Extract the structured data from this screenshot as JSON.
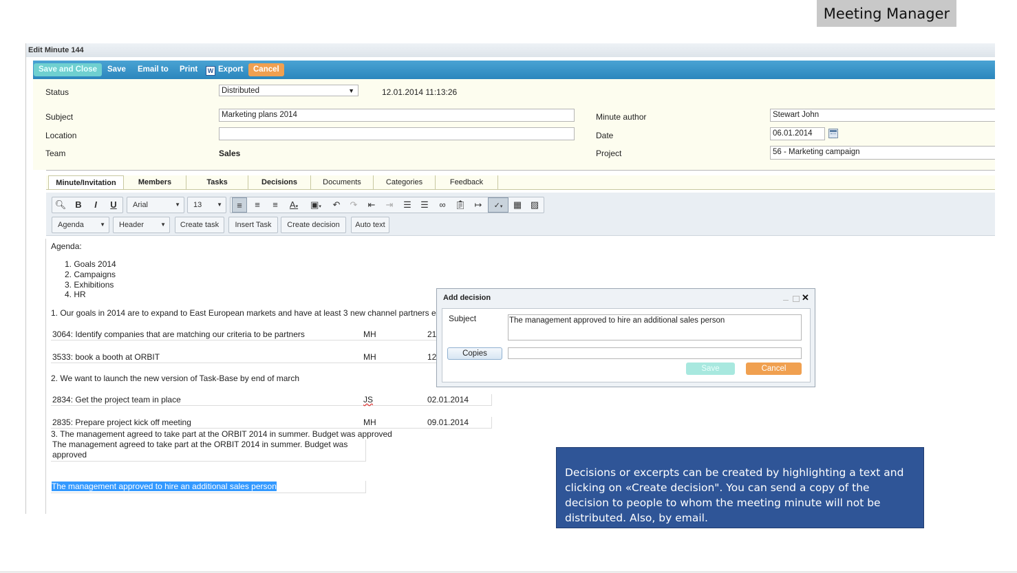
{
  "app_title": "Meeting Manager",
  "window_title": "Edit Minute 144",
  "toolbar": {
    "save_close": "Save and Close",
    "save": "Save",
    "email": "Email to",
    "print": "Print",
    "export": "Export",
    "export_icon": "W",
    "cancel": "Cancel"
  },
  "form": {
    "status_label": "Status",
    "status_value": "Distributed",
    "status_arrow": "▼",
    "timestamp": "12.01.2014 11:13:26",
    "subject_label": "Subject",
    "subject_value": "Marketing plans 2014",
    "location_label": "Location",
    "location_value": "",
    "team_label": "Team",
    "team_value": "Sales",
    "author_label": "Minute author",
    "author_value": "Stewart John",
    "date_label": "Date",
    "date_value": "06.01.2014",
    "project_label": "Project",
    "project_value": "56 - Marketing campaign"
  },
  "tabs": [
    "Minute/Invitation",
    "Members",
    "Tasks",
    "Decisions",
    "Documents",
    "Categories",
    "Feedback"
  ],
  "editor": {
    "font": "Arial",
    "size": "13",
    "agenda_combo": "Agenda",
    "header_combo": "Header",
    "create_task": "Create task",
    "insert_task": "Insert Task",
    "create_decision": "Create decision",
    "auto_text": "Auto text"
  },
  "content": {
    "agenda_heading": "Agenda:",
    "agenda_items": [
      "1.  Goals 2014",
      "2.  Campaigns",
      "3.  Exhibitions",
      "4.  HR"
    ],
    "point1": "1.  Our goals in 2014 are to expand to East European markets and have at least 3 new channel partners e",
    "task1": {
      "text": "3064: Identify companies that are matching our criteria to be partners",
      "who": "MH",
      "date": "21"
    },
    "task2": {
      "text": "3533: book a booth at ORBIT",
      "who": "MH",
      "date": "12"
    },
    "point2": "2.  We want to launch the new version of Task-Base by end of march",
    "task3": {
      "text": "2834: Get the project team in place",
      "who": "JS",
      "date": "02.01.2014"
    },
    "task4": {
      "text": "2835: Prepare project kick off meeting",
      "who": "MH",
      "date": "09.01.2014"
    },
    "point3": "3. The management agreed to take part at the ORBIT 2014 in summer. Budget was approved",
    "decision_box_line1": "The management agreed to take part at the ORBIT 2014 in summer. Budget was",
    "decision_box_line2": "approved",
    "highlighted": "The management approved to hire an additional sales person"
  },
  "dialog": {
    "title": "Add decision",
    "subject_label": "Subject",
    "subject_value": "The management approved to hire an additional sales person",
    "copies_button": "Copies",
    "save": "Save",
    "cancel": "Cancel",
    "close_glyph": "✕"
  },
  "note": "Decisions or excerpts can be created by highlighting a text and clicking on «Create decision\". You can send a copy of the decision to people to whom the meeting minute will not be distributed. Also, by email.",
  "colors": {
    "toolbar": "#2b86bd",
    "save_close": "#6fd0d0",
    "cancel": "#f0a050",
    "note_bg": "#2f5597",
    "highlight": "#3399ff"
  }
}
